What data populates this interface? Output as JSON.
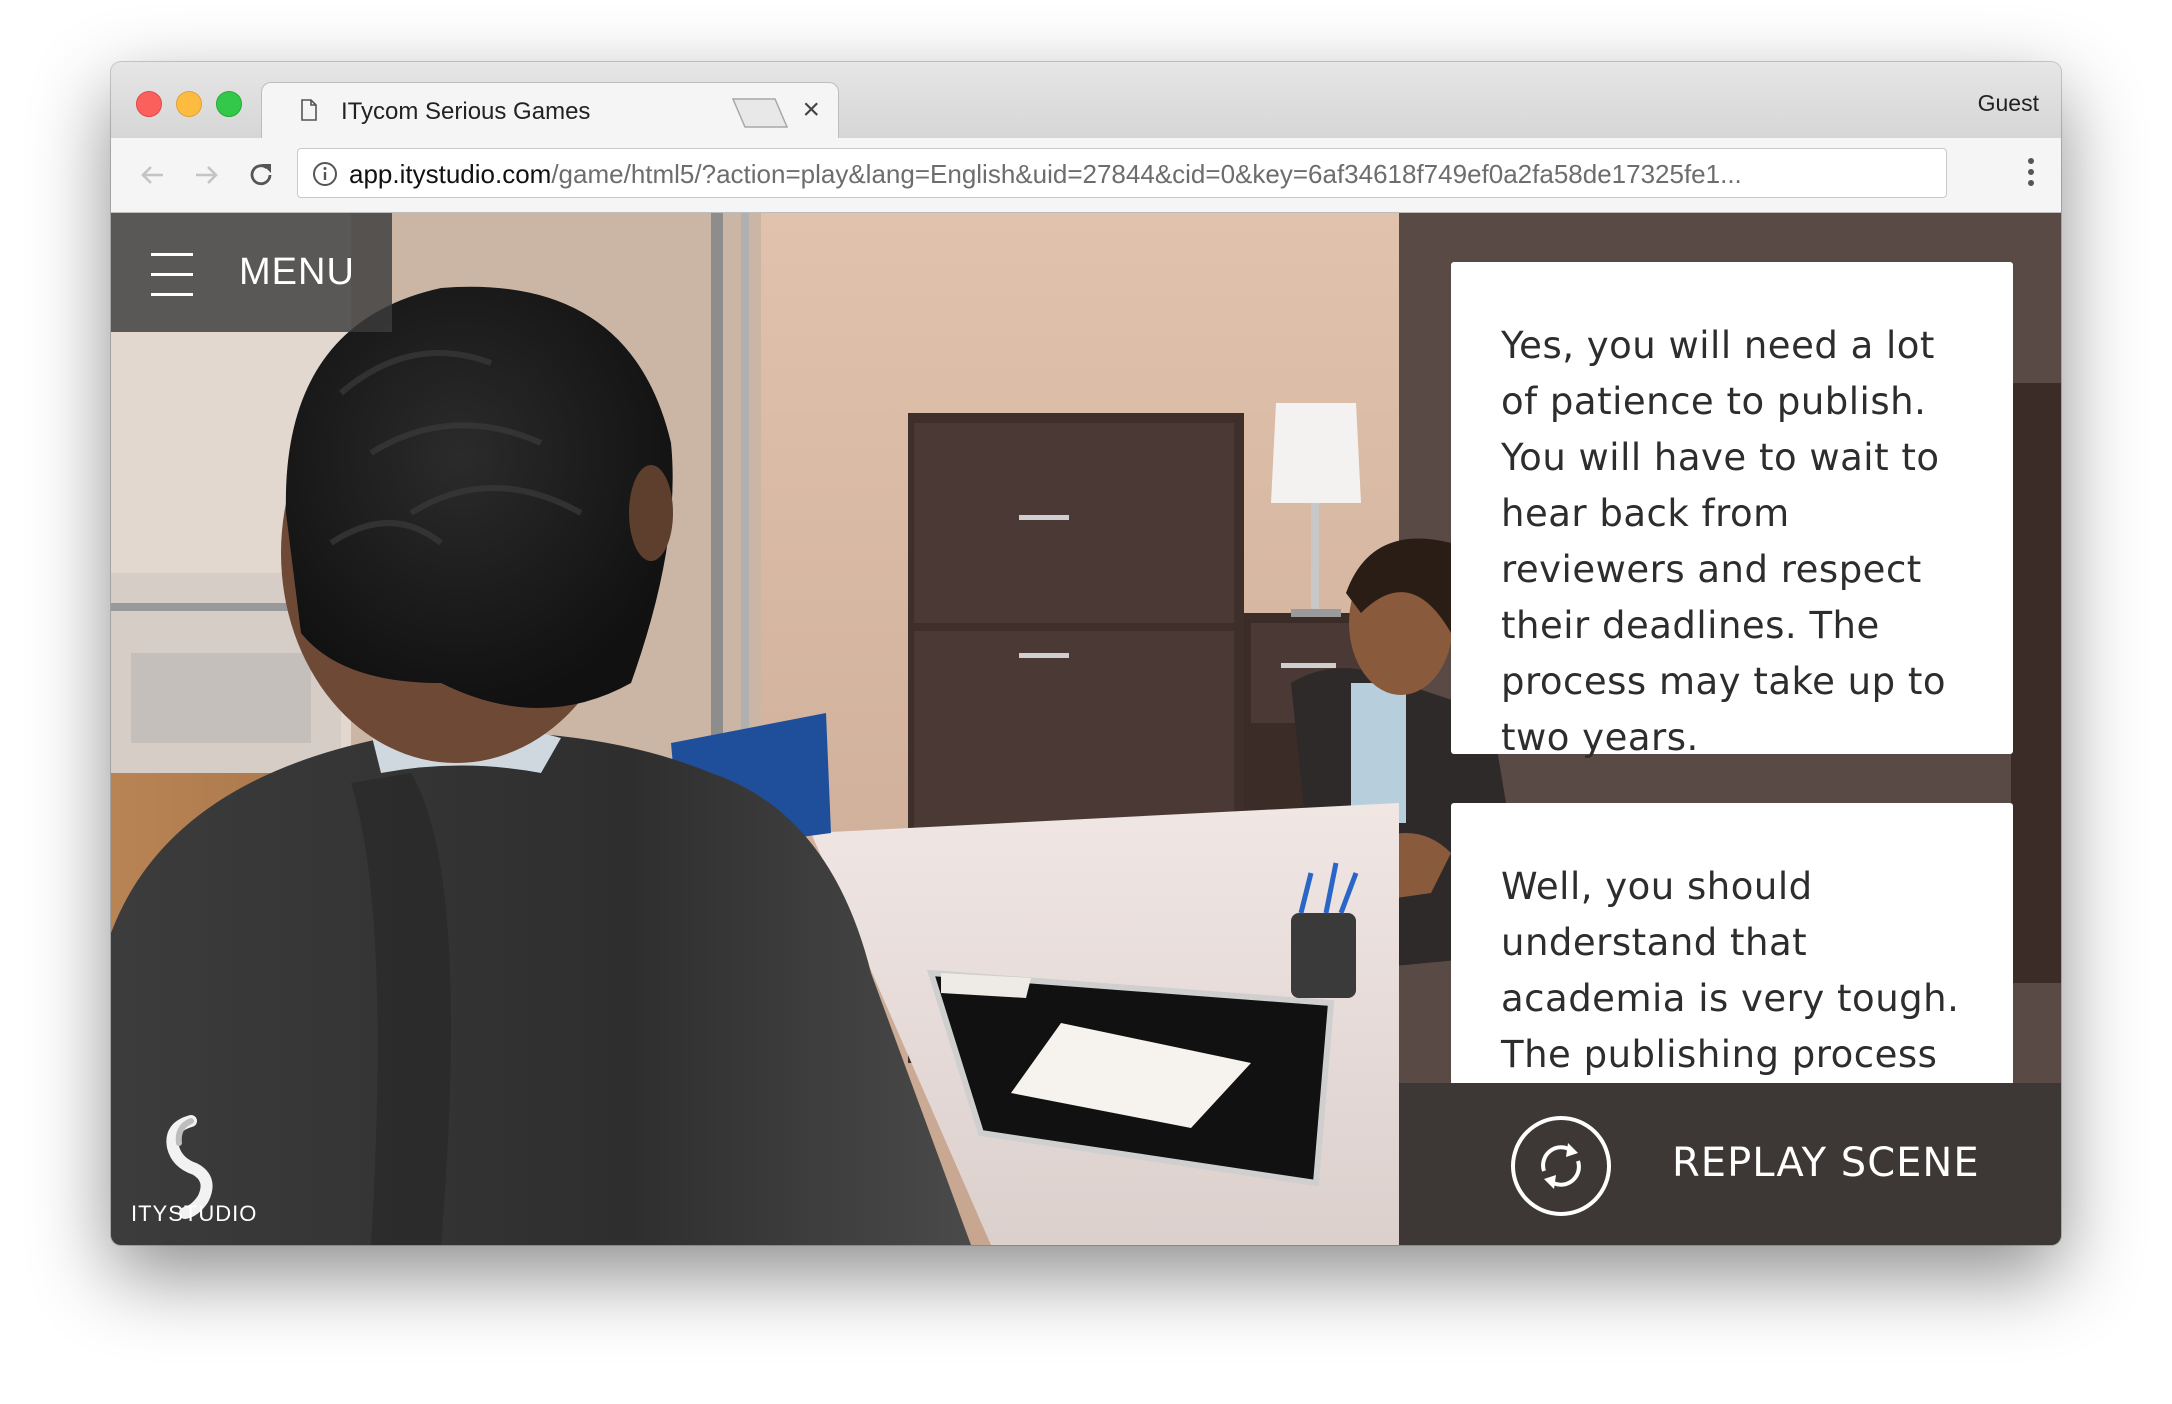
{
  "browser": {
    "tab_title": "ITycom Serious Games",
    "tab_close": "×",
    "profile": "Guest",
    "url_host": "app.itystudio.com",
    "url_path": "/game/html5/?action=play&lang=English&uid=27844&cid=0&key=6af34618f749ef0a2fa58de17325fe1..."
  },
  "game": {
    "menu_label": "MENU",
    "logo_text": "ITYSTUDIO",
    "answers": [
      "Yes, you will need a lot of patience to publish. You will have to wait to hear back from reviewers and respect their deadlines. The process may take up to two years.",
      "Well, you should understand that academia is very tough. The publishing process is"
    ],
    "replay_label": "REPLAY SCENE"
  }
}
